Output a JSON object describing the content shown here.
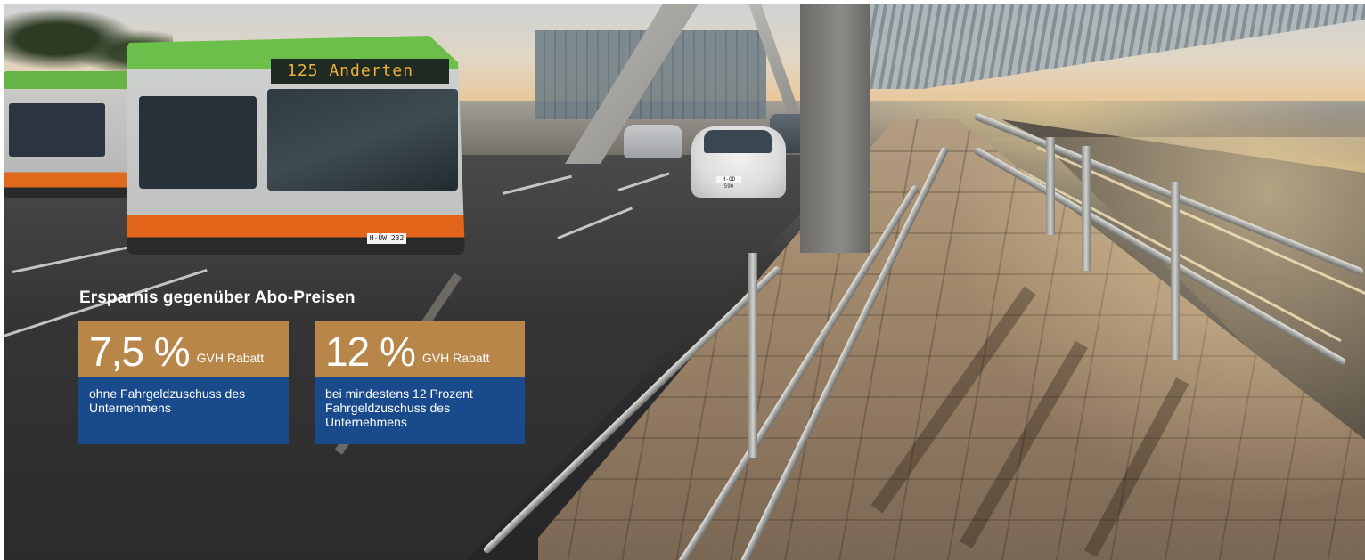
{
  "scene": {
    "bus_destination": "125 Anderten",
    "bus_plate": "H-ÜW 232",
    "car_plate": "H-OD 590"
  },
  "info": {
    "heading": "Ersparnis gegenüber Abo-Preisen",
    "offers": [
      {
        "rate": "7,5 %",
        "label": "GVH Rabatt",
        "description": "ohne Fahrgeldzuschuss des Unternehmens"
      },
      {
        "rate": "12 %",
        "label": "GVH Rabatt",
        "description": "bei mindestens 12 Prozent Fahrgeldzuschuss des Unternehmens"
      }
    ]
  },
  "colors": {
    "rate_box": "#b9864a",
    "description_box": "#184a8c",
    "text": "#ffffff"
  }
}
